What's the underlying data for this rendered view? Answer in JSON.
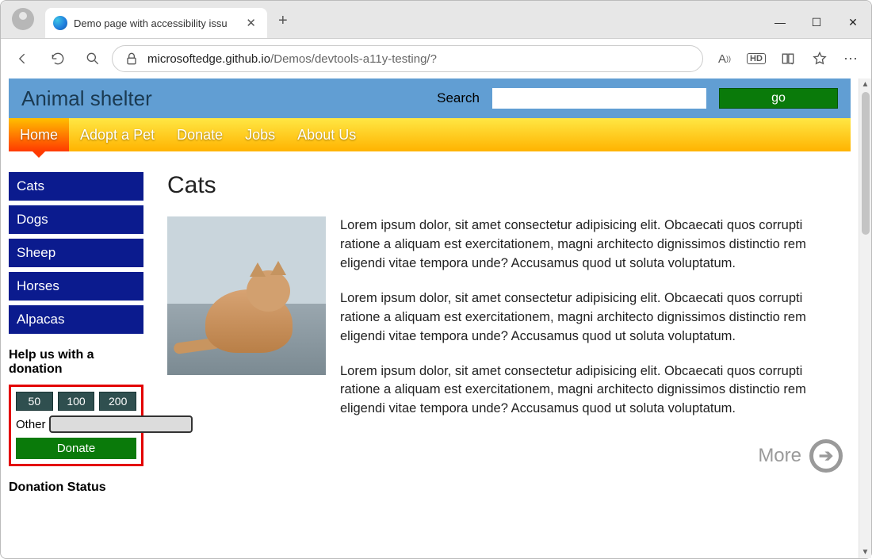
{
  "browser": {
    "tab_title": "Demo page with accessibility issu",
    "url_host": "microsoftedge.github.io",
    "url_path": "/Demos/devtools-a11y-testing/?"
  },
  "header": {
    "site_title": "Animal shelter",
    "search_label": "Search",
    "go_label": "go"
  },
  "nav": {
    "items": [
      {
        "label": "Home",
        "active": true
      },
      {
        "label": "Adopt a Pet"
      },
      {
        "label": "Donate"
      },
      {
        "label": "Jobs"
      },
      {
        "label": "About Us"
      }
    ]
  },
  "sidebar": {
    "links": [
      {
        "label": "Cats"
      },
      {
        "label": "Dogs"
      },
      {
        "label": "Sheep"
      },
      {
        "label": "Horses"
      },
      {
        "label": "Alpacas"
      }
    ],
    "donate_heading": "Help us with a donation",
    "amounts": [
      "50",
      "100",
      "200"
    ],
    "other_label": "Other",
    "donate_button": "Donate",
    "status_heading": "Donation Status"
  },
  "main": {
    "heading": "Cats",
    "paragraphs": [
      "Lorem ipsum dolor, sit amet consectetur adipisicing elit. Obcaecati quos corrupti ratione a aliquam est exercitationem, magni architecto dignissimos distinctio rem eligendi vitae tempora unde? Accusamus quod ut soluta voluptatum.",
      "Lorem ipsum dolor, sit amet consectetur adipisicing elit. Obcaecati quos corrupti ratione a aliquam est exercitationem, magni architecto dignissimos distinctio rem eligendi vitae tempora unde? Accusamus quod ut soluta voluptatum.",
      "Lorem ipsum dolor, sit amet consectetur adipisicing elit. Obcaecati quos corrupti ratione a aliquam est exercitationem, magni architecto dignissimos distinctio rem eligendi vitae tempora unde? Accusamus quod ut soluta voluptatum."
    ],
    "more_label": "More"
  }
}
